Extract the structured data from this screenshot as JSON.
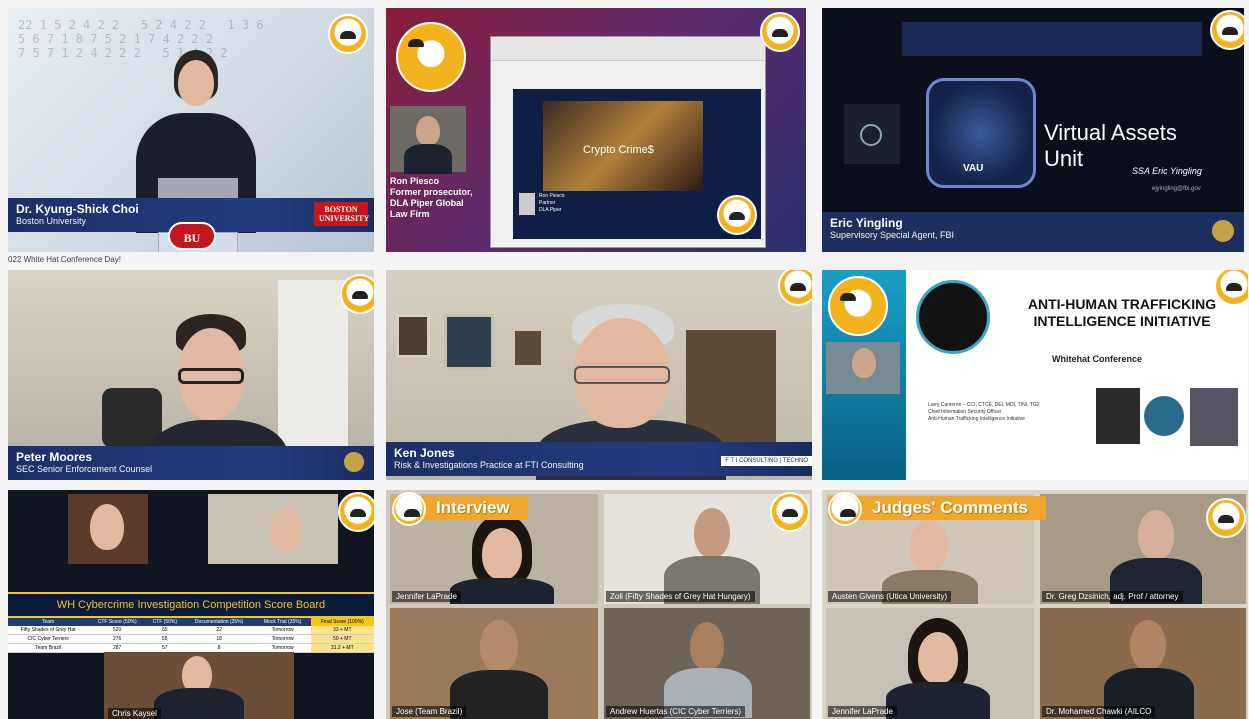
{
  "caption": "022 White Hat Conference Day!",
  "panels": {
    "p1": {
      "name": "Dr. Kyung-Shick Choi",
      "title": "Boston University",
      "logo": "BOSTON UNIVERSITY",
      "seal": "BU"
    },
    "p2": {
      "name": "Ron Piesco",
      "title1": "Former prosecutor,",
      "title2": "DLA Piper Global",
      "title3": "Law Firm",
      "slide_text": "Crypto Crime$",
      "slide_name": "Ron Piesco",
      "slide_role": "Partner",
      "slide_org": "DLA Piper"
    },
    "p3": {
      "name": "Eric Yingling",
      "title": "Supervisory Special Agent, FBI",
      "slide_title1": "Virtual Assets",
      "slide_title2": "Unit",
      "slide_agent": "SSA Eric Yingling",
      "slide_email": "ejyingling@fbi.gov",
      "vau": "VAU"
    },
    "p4": {
      "name": "Peter Moores",
      "title": "SEC Senior Enforcement Counsel"
    },
    "p5": {
      "name": "Ken Jones",
      "title": "Risk & Investigations Practice at FTI Consulting",
      "logo": "F T I  CONSULTING | TECHNO"
    },
    "p6": {
      "title1": "ANTI-HUMAN TRAFFICKING",
      "title2": "INTELLIGENCE INITIATIVE",
      "subtitle": "Whitehat Conference",
      "speaker_line1": "Larry Cameron – CCI, CTCE, DEI, MDI, TINI, TG2",
      "speaker_line2": "Chief Information Security Officer",
      "speaker_line3": "Anti-Human Trafficking Intelligence Initiative"
    },
    "p7": {
      "board_title": "WH Cybercrime Investigation Competition Score Board",
      "columns": [
        "Team",
        "CTF Score (50%)",
        "CTF (50%)",
        "Documentation (25%)",
        "Mock Trial (25%)",
        "Final Score (100%)"
      ],
      "rows": [
        [
          "Fifty Shades of Grey Hat",
          "520",
          "65",
          "22",
          "Tomorrow",
          "33 + MT"
        ],
        [
          "CIC Cyber Terriers",
          "276",
          "55",
          "18",
          "Tomorrow",
          "50 + MT"
        ],
        [
          "Team Brazil",
          "287",
          "57",
          "8",
          "Tomorrow",
          "31.2 + MT"
        ]
      ],
      "speaker": "Chris Kaysel"
    },
    "p8": {
      "ribbon": "Interview",
      "t1": "Jennifer LaPrade",
      "t2": "Zoli (Fifty Shades of Grey Hat Hungary)",
      "t3": "Jose (Team Brazil)",
      "t4": "Andrew Huertas (CIC Cyber Terriers)"
    },
    "p9": {
      "ribbon": "Judges' Comments",
      "t1": "Austen Givens (Utica University)",
      "t2": "Dr. Greg Dzsinich, adj. Prof / attorney",
      "t3": "Jennifer LaPrade",
      "t4": "Dr. Mohamed Chawki (AILCO"
    }
  },
  "colors": {
    "namebar": "#1c2f66",
    "ribbon": "#f0a62a",
    "badge": "#f2b31d"
  }
}
